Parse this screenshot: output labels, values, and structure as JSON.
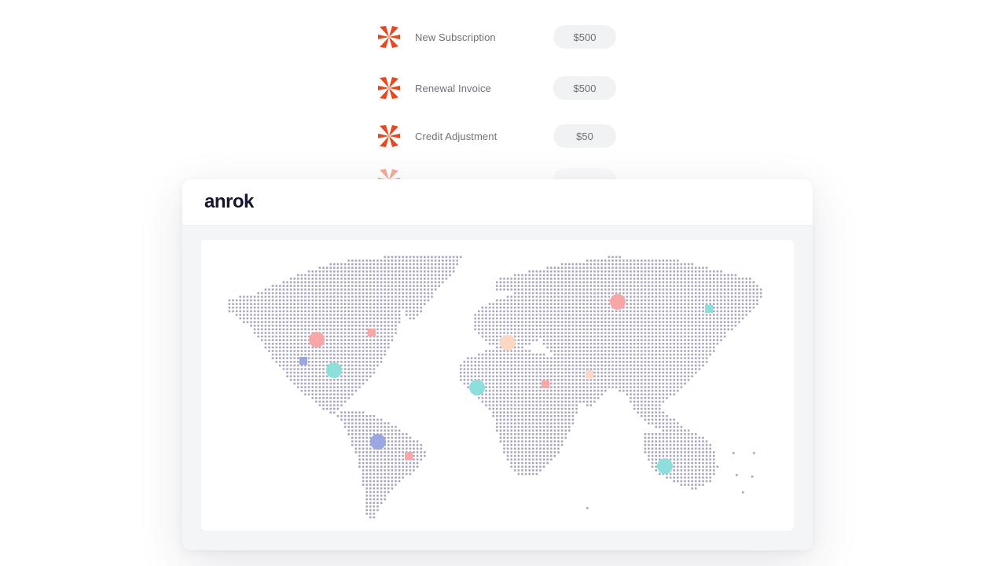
{
  "transactions": [
    {
      "label": "New Subscription",
      "amount": "$500"
    },
    {
      "label": "Renewal Invoice",
      "amount": "$500"
    },
    {
      "label": "Credit Adjustment",
      "amount": "$50"
    }
  ],
  "card": {
    "brand": "anrok"
  },
  "icons": {
    "transaction_logo": "starburst-logo-icon"
  },
  "colors": {
    "logo": "#e8471f",
    "map_dots": "#a7a6bd",
    "marker_pink": "#f9a7a6",
    "marker_teal": "#8ddfdc",
    "marker_blue": "#9aa7e0",
    "marker_peach": "#fcd7c4"
  }
}
